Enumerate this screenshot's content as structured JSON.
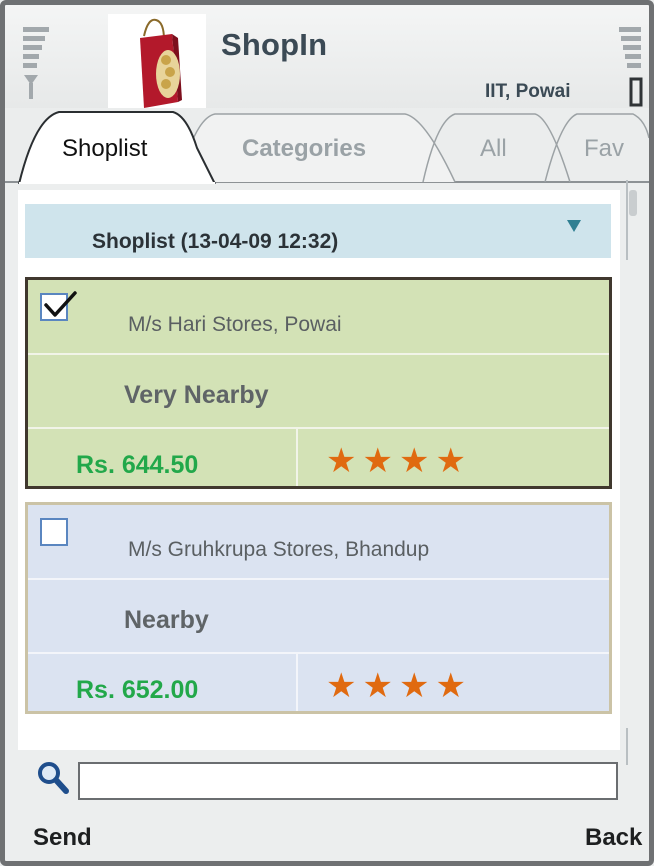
{
  "app": {
    "title": "ShopIn",
    "location": "IIT, Powai",
    "logo_icon": "shopping-bag-icon"
  },
  "tabs": [
    {
      "label": "Shoplist",
      "active": true
    },
    {
      "label": "Categories",
      "active": false
    },
    {
      "label": "All",
      "active": false
    },
    {
      "label": "Fav",
      "active": false
    }
  ],
  "list": {
    "title": "Shoplist (13-04-09 12:32)",
    "dropdown_icon": "triangle-down-icon",
    "shops": [
      {
        "name": "M/s Hari Stores, Powai",
        "distance": "Very Nearby",
        "price": "Rs. 644.50",
        "stars": "★★★★",
        "checked": true
      },
      {
        "name": "M/s Gruhkrupa Stores, Bhandup",
        "distance": "Nearby",
        "price": "Rs. 652.00",
        "stars": "★★★★",
        "checked": false
      }
    ]
  },
  "search": {
    "icon": "magnifier-icon",
    "value": "",
    "placeholder": ""
  },
  "softkeys": {
    "left": "Send",
    "right": "Back"
  },
  "colors": {
    "selected_card": "#d3e2b6",
    "normal_card": "#dbe3f1",
    "price": "#22a84a",
    "stars": "#e06a10",
    "list_header": "#cfe4ec"
  }
}
